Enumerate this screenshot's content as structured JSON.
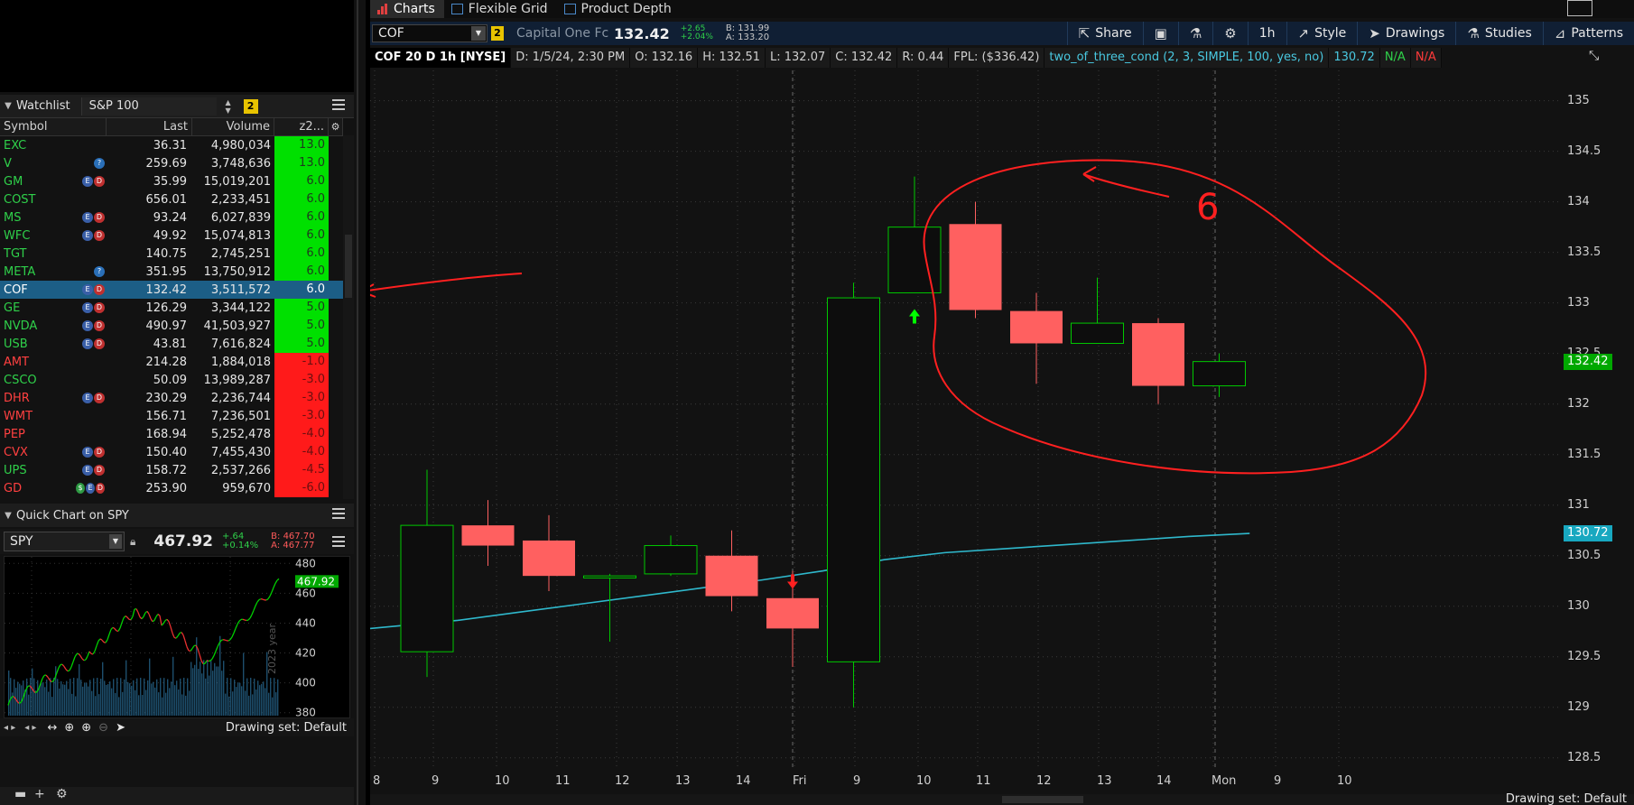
{
  "watchlist": {
    "title": "Watchlist",
    "list_name": "S&P 100",
    "link_number": "2",
    "columns": {
      "symbol": "Symbol",
      "last": "Last",
      "volume": "Volume",
      "z": "z2..."
    },
    "rows": [
      {
        "sym": "EXC",
        "icons": "",
        "last": "36.31",
        "vol": "4,980,034",
        "z": "13.0",
        "zc": "green",
        "symc": "#2fd04a"
      },
      {
        "sym": "V",
        "icons": "q",
        "last": "259.69",
        "vol": "3,748,636",
        "z": "13.0",
        "zc": "green",
        "symc": "#2fd04a"
      },
      {
        "sym": "GM",
        "icons": "br",
        "last": "35.99",
        "vol": "15,019,201",
        "z": "6.0",
        "zc": "green",
        "symc": "#2fd04a"
      },
      {
        "sym": "COST",
        "icons": "",
        "last": "656.01",
        "vol": "2,233,451",
        "z": "6.0",
        "zc": "green",
        "symc": "#2fd04a"
      },
      {
        "sym": "MS",
        "icons": "br",
        "last": "93.24",
        "vol": "6,027,839",
        "z": "6.0",
        "zc": "green",
        "symc": "#2fd04a"
      },
      {
        "sym": "WFC",
        "icons": "br",
        "last": "49.92",
        "vol": "15,074,813",
        "z": "6.0",
        "zc": "green",
        "symc": "#2fd04a"
      },
      {
        "sym": "TGT",
        "icons": "",
        "last": "140.75",
        "vol": "2,745,251",
        "z": "6.0",
        "zc": "green",
        "symc": "#2fd04a"
      },
      {
        "sym": "META",
        "icons": "q",
        "last": "351.95",
        "vol": "13,750,912",
        "z": "6.0",
        "zc": "green",
        "symc": "#2fd04a"
      },
      {
        "sym": "COF",
        "icons": "br",
        "last": "132.42",
        "vol": "3,511,572",
        "z": "6.0",
        "zc": "sel",
        "symc": "#ffffff"
      },
      {
        "sym": "GE",
        "icons": "br",
        "last": "126.29",
        "vol": "3,344,122",
        "z": "5.0",
        "zc": "green",
        "symc": "#2fd04a"
      },
      {
        "sym": "NVDA",
        "icons": "br",
        "last": "490.97",
        "vol": "41,503,927",
        "z": "5.0",
        "zc": "green",
        "symc": "#2fd04a"
      },
      {
        "sym": "USB",
        "icons": "br",
        "last": "43.81",
        "vol": "7,616,824",
        "z": "5.0",
        "zc": "green",
        "symc": "#2fd04a"
      },
      {
        "sym": "AMT",
        "icons": "",
        "last": "214.28",
        "vol": "1,884,018",
        "z": "-1.0",
        "zc": "red",
        "symc": "#ff4040"
      },
      {
        "sym": "CSCO",
        "icons": "",
        "last": "50.09",
        "vol": "13,989,287",
        "z": "-3.0",
        "zc": "red",
        "symc": "#2fd04a"
      },
      {
        "sym": "DHR",
        "icons": "br",
        "last": "230.29",
        "vol": "2,236,744",
        "z": "-3.0",
        "zc": "red",
        "symc": "#ff4040"
      },
      {
        "sym": "WMT",
        "icons": "",
        "last": "156.71",
        "vol": "7,236,501",
        "z": "-3.0",
        "zc": "red",
        "symc": "#ff4040"
      },
      {
        "sym": "PEP",
        "icons": "",
        "last": "168.94",
        "vol": "5,252,478",
        "z": "-4.0",
        "zc": "red",
        "symc": "#ff4040"
      },
      {
        "sym": "CVX",
        "icons": "br",
        "last": "150.40",
        "vol": "7,455,430",
        "z": "-4.0",
        "zc": "red",
        "symc": "#ff4040"
      },
      {
        "sym": "UPS",
        "icons": "br",
        "last": "158.72",
        "vol": "2,537,266",
        "z": "-4.5",
        "zc": "red",
        "symc": "#2fd04a"
      },
      {
        "sym": "GD",
        "icons": "gbr",
        "last": "253.90",
        "vol": "959,670",
        "z": "-6.0",
        "zc": "red",
        "symc": "#ff4040"
      }
    ]
  },
  "quick_chart": {
    "title": "Quick Chart on SPY",
    "symbol": "SPY",
    "price": "467.92",
    "change": "+.64",
    "change_pct": "+0.14%",
    "bid": "B: 467.70",
    "ask": "A: 467.77",
    "y_ticks": [
      "480",
      "460",
      "440",
      "420",
      "400",
      "380"
    ],
    "price_label": "467.92",
    "period_label": "2023 year",
    "drawing_set": "Drawing set: Default"
  },
  "tabs": [
    {
      "label": "Charts",
      "active": true
    },
    {
      "label": "Flexible Grid",
      "active": false
    },
    {
      "label": "Product Depth",
      "active": false
    }
  ],
  "toolbar": {
    "symbol": "COF",
    "link": "2",
    "name": "Capital One Fc",
    "price": "132.42",
    "change": "+2.65",
    "change_pct": "+2.04%",
    "bid": "B: 131.99",
    "ask": "A: 133.20",
    "share": "Share",
    "timeframe": "1h",
    "style": "Style",
    "drawings": "Drawings",
    "studies": "Studies",
    "patterns": "Patterns"
  },
  "infobar": {
    "title": "COF 20 D 1h [NYSE]",
    "date": "D: 1/5/24, 2:30 PM",
    "open": "O: 132.16",
    "high": "H: 132.51",
    "low": "L: 132.07",
    "close": "C: 132.42",
    "range": "R: 0.44",
    "fpl": "FPL: ($336.42)",
    "study": "two_of_three_cond (2, 3, SIMPLE, 100, yes, no)",
    "study_value": "130.72",
    "na1": "N/A",
    "na2": "N/A"
  },
  "chart_data": {
    "type": "candlestick",
    "y_ticks": [
      135,
      134.5,
      134,
      133.5,
      133,
      132.5,
      132,
      131.5,
      131,
      130.5,
      130,
      129.5,
      129,
      128.5
    ],
    "ylim": [
      128.4,
      135.3
    ],
    "x_ticks": [
      "8",
      "9",
      "10",
      "11",
      "12",
      "13",
      "14",
      "Fri",
      "9",
      "10",
      "11",
      "12",
      "13",
      "14",
      "Mon",
      "9",
      "10"
    ],
    "last_price_label": "132.42",
    "ma_label": "130.72",
    "candles": [
      {
        "o": 129.55,
        "h": 131.35,
        "l": 129.3,
        "c": 130.8
      },
      {
        "o": 130.8,
        "h": 131.05,
        "l": 130.4,
        "c": 130.6
      },
      {
        "o": 130.65,
        "h": 130.9,
        "l": 130.15,
        "c": 130.3
      },
      {
        "o": 130.28,
        "h": 130.32,
        "l": 129.65,
        "c": 130.3
      },
      {
        "o": 130.32,
        "h": 130.7,
        "l": 130.3,
        "c": 130.6
      },
      {
        "o": 130.5,
        "h": 130.75,
        "l": 129.95,
        "c": 130.1
      },
      {
        "o": 130.08,
        "h": 130.35,
        "l": 129.4,
        "c": 129.78
      },
      {
        "o": 129.45,
        "h": 133.2,
        "l": 129.0,
        "c": 133.05
      },
      {
        "o": 133.1,
        "h": 134.25,
        "l": 133.1,
        "c": 133.75
      },
      {
        "o": 133.78,
        "h": 134.0,
        "l": 132.85,
        "c": 132.93
      },
      {
        "o": 132.92,
        "h": 133.1,
        "l": 132.2,
        "c": 132.6
      },
      {
        "o": 132.6,
        "h": 133.25,
        "l": 132.6,
        "c": 132.8
      },
      {
        "o": 132.8,
        "h": 132.85,
        "l": 132.0,
        "c": 132.18
      },
      {
        "o": 132.18,
        "h": 132.5,
        "l": 132.07,
        "c": 132.42
      }
    ],
    "moving_average": [
      129.78,
      129.86,
      129.94,
      130.02,
      130.1,
      130.18,
      130.26,
      130.35,
      130.46,
      130.53,
      130.57,
      130.61,
      130.65,
      130.69,
      130.72
    ],
    "annotation_text": "6"
  },
  "colors": {
    "up": "#00c800",
    "down": "#ff6060",
    "ma": "#2fb8cc",
    "annotation": "#ff2020",
    "grid": "#3a3a3a"
  }
}
